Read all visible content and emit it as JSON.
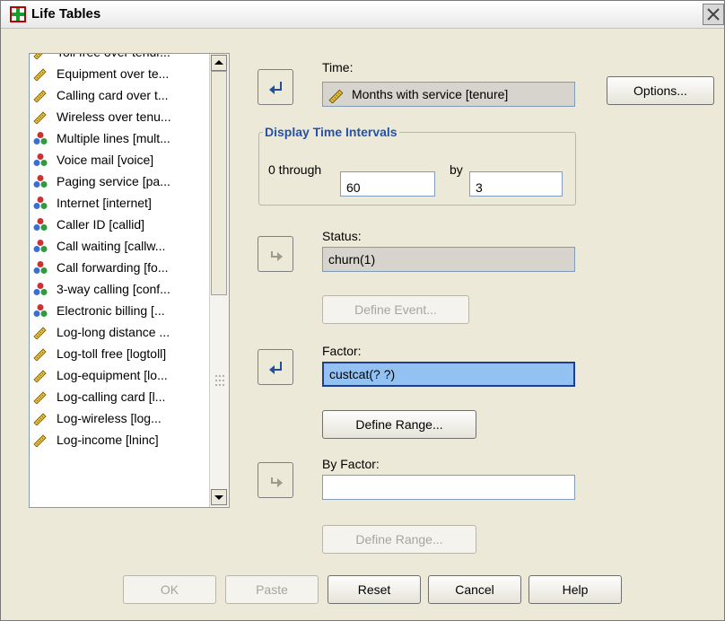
{
  "window": {
    "title": "Life Tables",
    "close_icon": "close-icon"
  },
  "variables": [
    {
      "icon": "ruler-icon",
      "label": "Toll free over tenur..."
    },
    {
      "icon": "ruler-icon",
      "label": "Equipment over te..."
    },
    {
      "icon": "ruler-icon",
      "label": "Calling card over t..."
    },
    {
      "icon": "ruler-icon",
      "label": "Wireless over tenu..."
    },
    {
      "icon": "nominal-icon",
      "label": "Multiple lines [mult..."
    },
    {
      "icon": "nominal-icon",
      "label": "Voice mail [voice]"
    },
    {
      "icon": "nominal-icon",
      "label": "Paging service [pa..."
    },
    {
      "icon": "nominal-icon",
      "label": "Internet [internet]"
    },
    {
      "icon": "nominal-icon",
      "label": "Caller ID [callid]"
    },
    {
      "icon": "nominal-icon",
      "label": "Call waiting [callw..."
    },
    {
      "icon": "nominal-icon",
      "label": "Call forwarding [fo..."
    },
    {
      "icon": "nominal-icon",
      "label": "3-way calling [conf..."
    },
    {
      "icon": "nominal-icon",
      "label": "Electronic billing [..."
    },
    {
      "icon": "ruler-icon",
      "label": "Log-long distance ..."
    },
    {
      "icon": "ruler-icon",
      "label": "Log-toll free [logtoll]"
    },
    {
      "icon": "ruler-icon",
      "label": "Log-equipment [lo..."
    },
    {
      "icon": "ruler-icon",
      "label": "Log-calling card [l..."
    },
    {
      "icon": "ruler-icon",
      "label": "Log-wireless [log..."
    },
    {
      "icon": "ruler-icon",
      "label": "Log-income [lninc]"
    }
  ],
  "time": {
    "label": "Time:",
    "value": "Months with service [tenure]"
  },
  "display_intervals": {
    "title": "Display Time Intervals",
    "through_label": "0 through",
    "through_value": "60",
    "by_label": "by",
    "by_value": "3"
  },
  "status": {
    "label": "Status:",
    "value": "churn(1)"
  },
  "define_event_label": "Define Event...",
  "factor": {
    "label": "Factor:",
    "value": "custcat(? ?)"
  },
  "define_range_label": "Define Range...",
  "by_factor": {
    "label": "By Factor:",
    "value": ""
  },
  "define_range2_label": "Define Range...",
  "options_label": "Options...",
  "buttons": {
    "ok": "OK",
    "paste": "Paste",
    "reset": "Reset",
    "cancel": "Cancel",
    "help": "Help"
  },
  "colors": {
    "accent_blue": "#2452a8",
    "selection": "#93c2f2",
    "dialog_bg": "#ece9d8"
  }
}
